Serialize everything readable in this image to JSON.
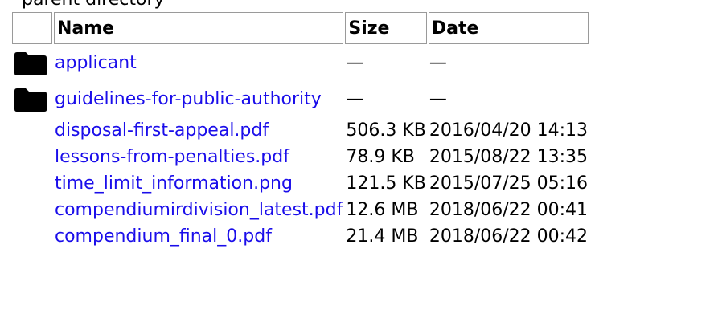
{
  "page": {
    "top_text": "parent directory"
  },
  "table": {
    "headers": {
      "name": "Name",
      "size": "Size",
      "date": "Date"
    },
    "rows": [
      {
        "type": "folder",
        "icon": "folder-icon",
        "name": "applicant",
        "size": "—",
        "date": "—"
      },
      {
        "type": "folder",
        "icon": "folder-icon",
        "name": "guidelines-for-public-authority",
        "size": "—",
        "date": "—"
      },
      {
        "type": "file",
        "name": "disposal-first-appeal.pdf",
        "size": "506.3 KB",
        "date": "2016/04/20 14:13"
      },
      {
        "type": "file",
        "name": "lessons-from-penalties.pdf",
        "size": "78.9 KB",
        "date": "2015/08/22 13:35"
      },
      {
        "type": "file",
        "name": "time_limit_information.png",
        "size": "121.5 KB",
        "date": "2015/07/25 05:16"
      },
      {
        "type": "file",
        "name": "compendiumirdivision_latest.pdf",
        "size": "12.6 MB",
        "date": "2018/06/22 00:41"
      },
      {
        "type": "file",
        "name": "compendium_final_0.pdf",
        "size": "21.4 MB",
        "date": "2018/06/22 00:42"
      }
    ]
  },
  "colors": {
    "link": "#1a0dea",
    "border": "#9a9a9a",
    "icon": "#000000"
  }
}
